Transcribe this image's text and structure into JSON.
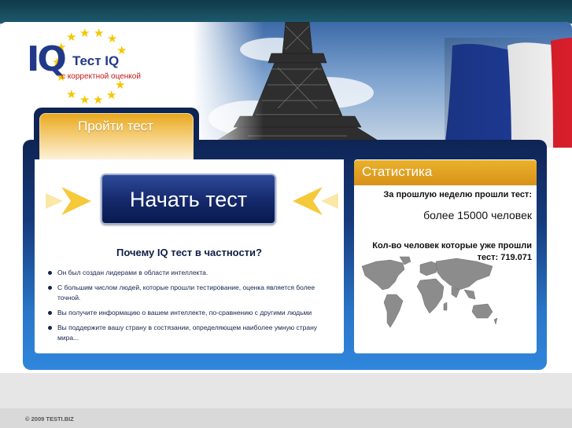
{
  "logo": {
    "iq_mark": "IQ",
    "title": "Тест IQ",
    "subtitle": "с корректной оценкой"
  },
  "tab": {
    "label": "Пройти тест"
  },
  "main": {
    "start_button": "Начать тест",
    "why_title": "Почему IQ тест в частности?",
    "reasons": [
      "Он был создан лидерами в области интеллекта.",
      "С большим числом людей, которые прошли тестирование, оценка является более точной.",
      "Вы получите информацию о вашем интеллекте, по-сравнению с другими людьми",
      "Вы поддержите вашу страну в состязании, определяющем наиболее умную страну мира..."
    ]
  },
  "stats": {
    "header": "Статистика",
    "last_week_label": "За прошлую неделю прошли тест:",
    "last_week_value": "более 15000 человек",
    "total_label": "Кол-во человек которые уже прошли тест: 719.071"
  },
  "footer": {
    "copyright": "© 2009 TESTI.BIZ"
  },
  "colors": {
    "brand_blue": "#22398a",
    "accent_gold": "#e8a81f",
    "frame_dark": "#0e2454",
    "frame_light": "#2f86dc",
    "star_yellow": "#f4c800"
  }
}
